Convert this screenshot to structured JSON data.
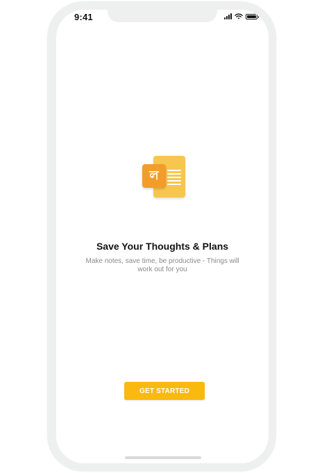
{
  "status_bar": {
    "time": "9:41",
    "icons": [
      "cellular-signal-icon",
      "wifi-icon",
      "battery-icon"
    ]
  },
  "app": {
    "logo_icon": "notes-app-logo-icon",
    "logo_glyph": "ল",
    "colors": {
      "logo_primary": "#F29C2B",
      "logo_secondary": "#F6C64E",
      "button": "#F9B90F"
    }
  },
  "onboarding": {
    "headline": "Save Your Thoughts & Plans",
    "subtext": "Make notes, save time, be productive - Things will work out for you",
    "cta_label": "GET STARTED"
  }
}
